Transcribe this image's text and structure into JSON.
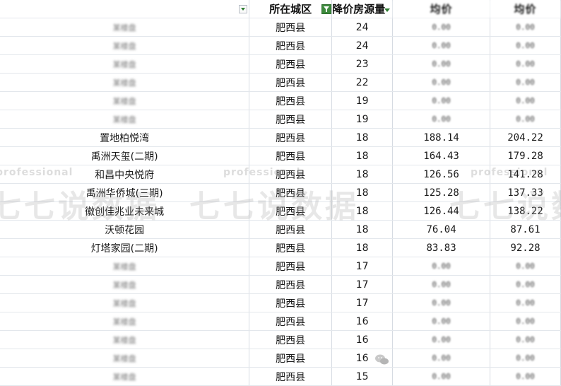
{
  "headers": {
    "name": "",
    "district": "所在城区",
    "count": "降价房源量",
    "price_before": "均价",
    "price_after": "均价"
  },
  "rows": [
    {
      "name": "某楼盘",
      "district": "肥西县",
      "count": "24",
      "a": "0.00",
      "b": "0.00",
      "blur": true
    },
    {
      "name": "某楼盘",
      "district": "肥西县",
      "count": "24",
      "a": "0.00",
      "b": "0.00",
      "blur": true
    },
    {
      "name": "某楼盘",
      "district": "肥西县",
      "count": "23",
      "a": "0.00",
      "b": "0.00",
      "blur": true
    },
    {
      "name": "某楼盘",
      "district": "肥西县",
      "count": "22",
      "a": "0.00",
      "b": "0.00",
      "blur": true
    },
    {
      "name": "某楼盘",
      "district": "肥西县",
      "count": "19",
      "a": "0.00",
      "b": "0.00",
      "blur": true
    },
    {
      "name": "某楼盘",
      "district": "肥西县",
      "count": "19",
      "a": "0.00",
      "b": "0.00",
      "blur": true
    },
    {
      "name": "置地柏悦湾",
      "district": "肥西县",
      "count": "18",
      "a": "188.14",
      "b": "204.22",
      "blur": false
    },
    {
      "name": "禹洲天玺(二期)",
      "district": "肥西县",
      "count": "18",
      "a": "164.43",
      "b": "179.28",
      "blur": false
    },
    {
      "name": "和昌中央悦府",
      "district": "肥西县",
      "count": "18",
      "a": "126.56",
      "b": "141.28",
      "blur": false
    },
    {
      "name": "禹洲华侨城(三期)",
      "district": "肥西县",
      "count": "18",
      "a": "125.28",
      "b": "137.33",
      "blur": false
    },
    {
      "name": "徽创佳兆业未来城",
      "district": "肥西县",
      "count": "18",
      "a": "126.44",
      "b": "138.22",
      "blur": false
    },
    {
      "name": "沃顿花园",
      "district": "肥西县",
      "count": "18",
      "a": "76.04",
      "b": "87.61",
      "blur": false
    },
    {
      "name": "灯塔家园(二期)",
      "district": "肥西县",
      "count": "18",
      "a": "83.83",
      "b": "92.28",
      "blur": false
    },
    {
      "name": "某楼盘",
      "district": "肥西县",
      "count": "17",
      "a": "0.00",
      "b": "0.00",
      "blur": true
    },
    {
      "name": "某楼盘",
      "district": "肥西县",
      "count": "17",
      "a": "0.00",
      "b": "0.00",
      "blur": true
    },
    {
      "name": "某楼盘",
      "district": "肥西县",
      "count": "17",
      "a": "0.00",
      "b": "0.00",
      "blur": true
    },
    {
      "name": "某楼盘",
      "district": "肥西县",
      "count": "16",
      "a": "0.00",
      "b": "0.00",
      "blur": true
    },
    {
      "name": "某楼盘",
      "district": "肥西县",
      "count": "16",
      "a": "0.00",
      "b": "0.00",
      "blur": true
    },
    {
      "name": "某楼盘",
      "district": "肥西县",
      "count": "16",
      "a": "0.00",
      "b": "0.00",
      "blur": true
    },
    {
      "name": "某楼盘",
      "district": "肥西县",
      "count": "15",
      "a": "0.00",
      "b": "0.00",
      "blur": true
    }
  ],
  "watermark": {
    "small": "professional",
    "big": "七七说数据"
  },
  "colors": {
    "filter_green": "#3d8a3d",
    "grid_line": "#d6dbe2"
  }
}
